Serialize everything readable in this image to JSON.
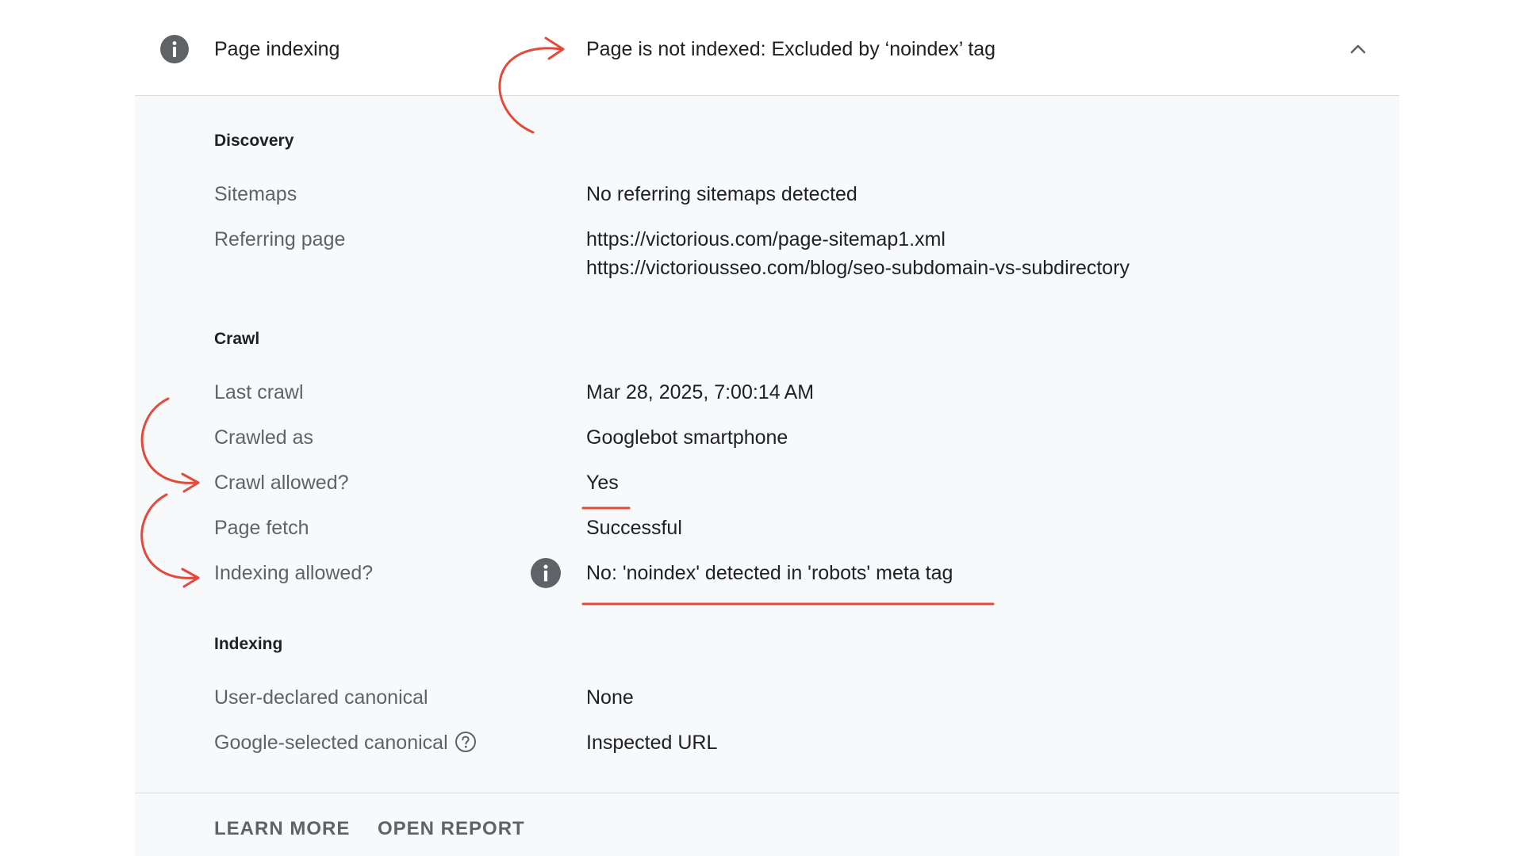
{
  "header": {
    "title": "Page indexing",
    "status": "Page is not indexed: Excluded by ‘noindex’ tag",
    "icon": "info-icon",
    "collapse_icon": "chevron-up-icon"
  },
  "discovery": {
    "title": "Discovery",
    "sitemaps_label": "Sitemaps",
    "sitemaps_value": "No referring sitemaps detected",
    "referring_label": "Referring page",
    "referring_value_1": "https://victorious.com/page-sitemap1.xml",
    "referring_value_2": "https://victoriousseo.com/blog/seo-subdomain-vs-subdirectory"
  },
  "crawl": {
    "title": "Crawl",
    "last_crawl_label": "Last crawl",
    "last_crawl_value": "Mar 28, 2025, 7:00:14 AM",
    "crawled_as_label": "Crawled as",
    "crawled_as_value": "Googlebot smartphone",
    "crawl_allowed_label": "Crawl allowed?",
    "crawl_allowed_value": "Yes",
    "page_fetch_label": "Page fetch",
    "page_fetch_value": "Successful",
    "indexing_allowed_label": "Indexing allowed?",
    "indexing_allowed_value": "No: 'noindex' detected in 'robots' meta tag"
  },
  "indexing": {
    "title": "Indexing",
    "user_canonical_label": "User-declared canonical",
    "user_canonical_value": "None",
    "google_canonical_label": "Google-selected canonical",
    "google_canonical_value": "Inspected URL"
  },
  "footer": {
    "learn_more": "LEARN MORE",
    "open_report": "OPEN REPORT"
  },
  "colors": {
    "annotation_red": "#e24a3b",
    "icon_gray": "#5f6368",
    "panel_bg": "#f8f9fa"
  }
}
